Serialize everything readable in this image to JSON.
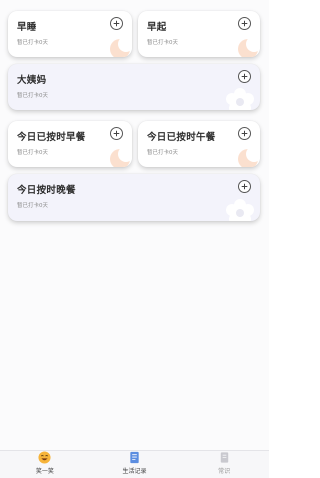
{
  "cards": [
    {
      "title": "早睡",
      "subtitle": "暂已打卡0天",
      "add_label": "+"
    },
    {
      "title": "早起",
      "subtitle": "暂已打卡0天",
      "add_label": "+"
    },
    {
      "title": "大姨妈",
      "subtitle": "暂已打卡0天",
      "add_label": "+"
    },
    {
      "title": "今日已按时早餐",
      "subtitle": "暂已打卡0天",
      "add_label": "+"
    },
    {
      "title": "今日已按时午餐",
      "subtitle": "暂已打卡0天",
      "add_label": "+"
    },
    {
      "title": "今日按时晚餐",
      "subtitle": "暂已打卡0天",
      "add_label": "+"
    }
  ],
  "tabbar": {
    "tabs": [
      {
        "label": "笑一笑",
        "icon": "smile-emoji-icon"
      },
      {
        "label": "生活记录",
        "icon": "record-document-icon"
      },
      {
        "label": "常识",
        "icon": "book-icon"
      }
    ]
  },
  "colors": {
    "card_small_bg": "#ffffff",
    "card_wide_bg": "#f3f3fb",
    "deco_orange": "#fbe0cf",
    "deco_white": "#ffffff",
    "tab_active_accent": "#f6b43a",
    "tab_record_accent": "#5b8de0"
  }
}
